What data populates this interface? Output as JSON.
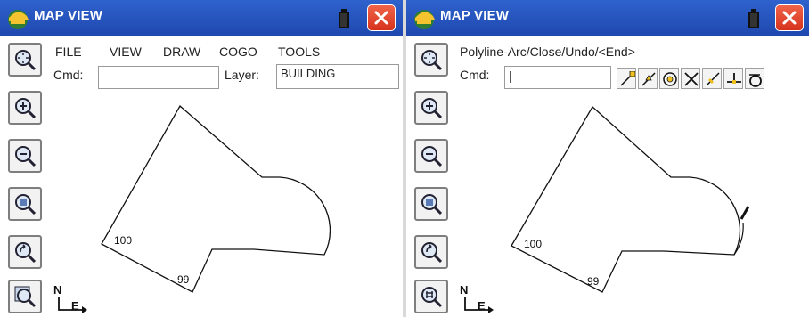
{
  "colors": {
    "titlebar": "#2a58c4",
    "close": "#e0452c",
    "outline": "#111111"
  },
  "left": {
    "title": "MAP VIEW",
    "menu": [
      "FILE",
      "VIEW",
      "DRAW",
      "COGO",
      "TOOLS"
    ],
    "cmd_label": "Cmd:",
    "cmd_value": "",
    "layer_label": "Layer:",
    "layer_value": "BUILDING",
    "point_labels": [
      "100",
      "99"
    ],
    "north": "N",
    "east": "E",
    "toolbar_icons": [
      "zoom-extents-icon",
      "zoom-in-icon",
      "zoom-out-icon",
      "zoom-window-icon",
      "zoom-previous-icon",
      "zoom-settings-icon"
    ]
  },
  "right": {
    "title": "MAP VIEW",
    "prompt": "Polyline-Arc/Close/Undo/<End>",
    "cmd_label": "Cmd:",
    "cmd_value": "|",
    "point_labels": [
      "100",
      "99"
    ],
    "north": "N",
    "east": "E",
    "snap_tools": [
      "snap-endpoint-icon",
      "snap-midpoint-icon",
      "snap-center-icon",
      "snap-intersection-icon",
      "snap-nearest-icon",
      "snap-perpendicular-icon",
      "snap-tangent-icon"
    ],
    "toolbar_icons": [
      "zoom-extents-icon",
      "zoom-in-icon",
      "zoom-out-icon",
      "zoom-window-icon",
      "zoom-previous-icon",
      "grid-settings-icon"
    ]
  }
}
